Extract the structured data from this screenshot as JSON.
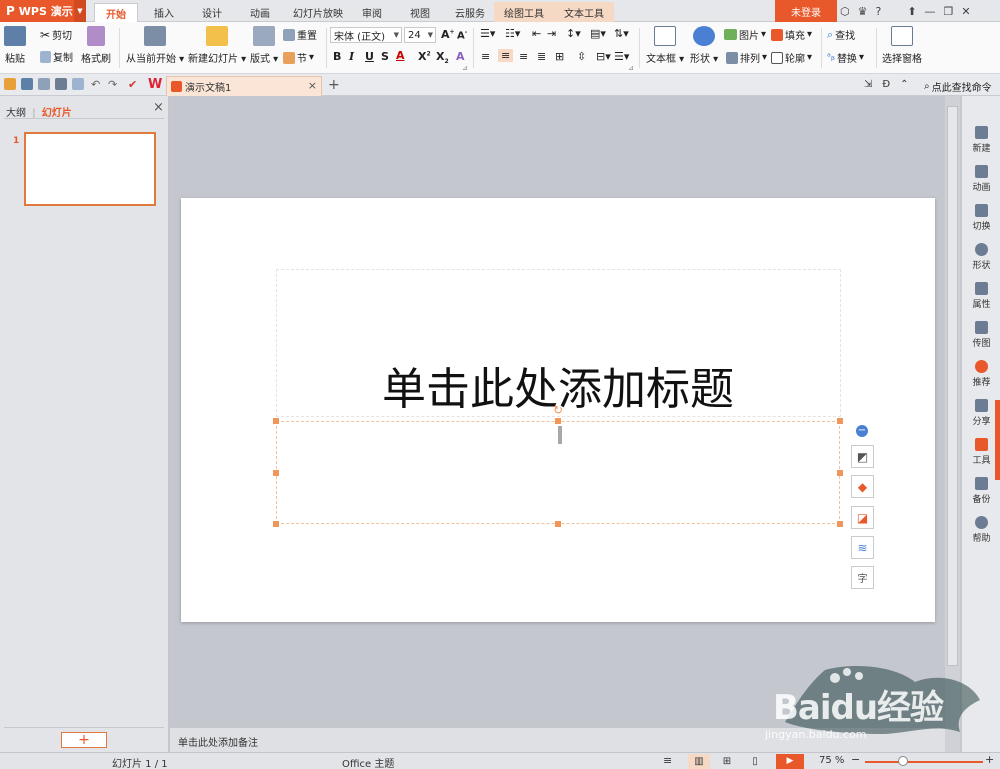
{
  "app": {
    "name": "WPS 演示",
    "logo": "P"
  },
  "tabs": [
    {
      "label": "开始",
      "active": true
    },
    {
      "label": "插入"
    },
    {
      "label": "设计"
    },
    {
      "label": "动画"
    },
    {
      "label": "幻灯片放映"
    },
    {
      "label": "审阅"
    },
    {
      "label": "视图"
    },
    {
      "label": "云服务"
    },
    {
      "label": "绘图工具",
      "contextual": true
    },
    {
      "label": "文本工具",
      "contextual": true
    }
  ],
  "login": "未登录",
  "ribbon": {
    "paste": "粘贴",
    "cut": "剪切",
    "copy": "复制",
    "format_painter": "格式刷",
    "from_current": "从当前开始",
    "new_slide": "新建幻灯片",
    "layout": "版式",
    "reset": "重置",
    "section": "节",
    "font_name": "宋体 (正文)",
    "font_size": "24",
    "text_box": "文本框",
    "shape": "形状",
    "picture": "图片",
    "fill": "填充",
    "find": "查找",
    "arrange": "排列",
    "outline": "轮廓",
    "replace": "替换",
    "selection_pane": "选择窗格"
  },
  "doc_tab": {
    "name": "演示文稿1"
  },
  "search_cmd": "点此查找命令",
  "left_panel": {
    "outline": "大纲",
    "slides": "幻灯片",
    "slide_number": "1"
  },
  "slide": {
    "title_placeholder": "单击此处添加标题"
  },
  "right_panel": [
    {
      "label": "新建",
      "icon": "new-icon",
      "color": "#6b7c93"
    },
    {
      "label": "动画",
      "icon": "animation-icon",
      "color": "#6b7c93"
    },
    {
      "label": "切换",
      "icon": "transition-icon",
      "color": "#6b7c93"
    },
    {
      "label": "形状",
      "icon": "shape-icon",
      "color": "#6b7c93"
    },
    {
      "label": "属性",
      "icon": "properties-icon",
      "color": "#6b7c93"
    },
    {
      "label": "传图",
      "icon": "upload-image-icon",
      "color": "#6b7c93"
    },
    {
      "label": "推荐",
      "icon": "recommend-icon",
      "color": "#e8582a"
    },
    {
      "label": "分享",
      "icon": "share-icon",
      "color": "#6b7c93"
    },
    {
      "label": "工具",
      "icon": "tools-icon",
      "color": "#e8582a"
    },
    {
      "label": "备份",
      "icon": "backup-icon",
      "color": "#6b7c93"
    },
    {
      "label": "帮助",
      "icon": "help-icon",
      "color": "#6b7c93"
    }
  ],
  "notes_placeholder": "单击此处添加备注",
  "status": {
    "slide_count": "幻灯片 1 / 1",
    "theme": "Office 主题",
    "zoom": "75 %"
  },
  "watermark": {
    "brand": "Baidu经验",
    "url": "jingyan.baidu.com"
  },
  "colors": {
    "accent": "#e8582a",
    "contextual_tab": "#f6d9c5"
  }
}
